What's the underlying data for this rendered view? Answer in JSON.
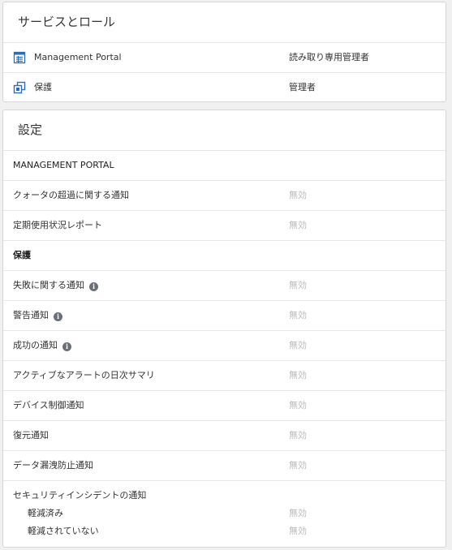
{
  "services": {
    "title": "サービスとロール",
    "items": [
      {
        "label": "Management Portal",
        "role": "読み取り専用管理者",
        "icon": "portal-icon"
      },
      {
        "label": "保護",
        "role": "管理者",
        "icon": "protection-icon"
      }
    ]
  },
  "settings": {
    "title": "設定",
    "section1": "MANAGEMENT PORTAL",
    "rows1": [
      {
        "label": "クォータの超過に関する通知",
        "value": "無効"
      },
      {
        "label": "定期使用状況レポート",
        "value": "無効"
      }
    ],
    "section2": "保護",
    "rows2": [
      {
        "label": "失敗に関する通知",
        "value": "無効",
        "info": true
      },
      {
        "label": "警告通知",
        "value": "無効",
        "info": true
      },
      {
        "label": "成功の通知",
        "value": "無効",
        "info": true
      },
      {
        "label": "アクティブなアラートの日次サマリ",
        "value": "無効"
      },
      {
        "label": "デバイス制御通知",
        "value": "無効"
      },
      {
        "label": "復元通知",
        "value": "無効"
      },
      {
        "label": "データ漏洩防止通知",
        "value": "無効"
      }
    ],
    "incident": {
      "label": "セキュリティインシデントの通知",
      "sub": [
        {
          "label": "軽減済み",
          "value": "無効"
        },
        {
          "label": "軽減されていない",
          "value": "無効"
        }
      ]
    }
  },
  "colors": {
    "icon_blue": "#2a6ebb",
    "disabled_text": "#bbbbbb",
    "info_icon": "#6b6f78"
  }
}
